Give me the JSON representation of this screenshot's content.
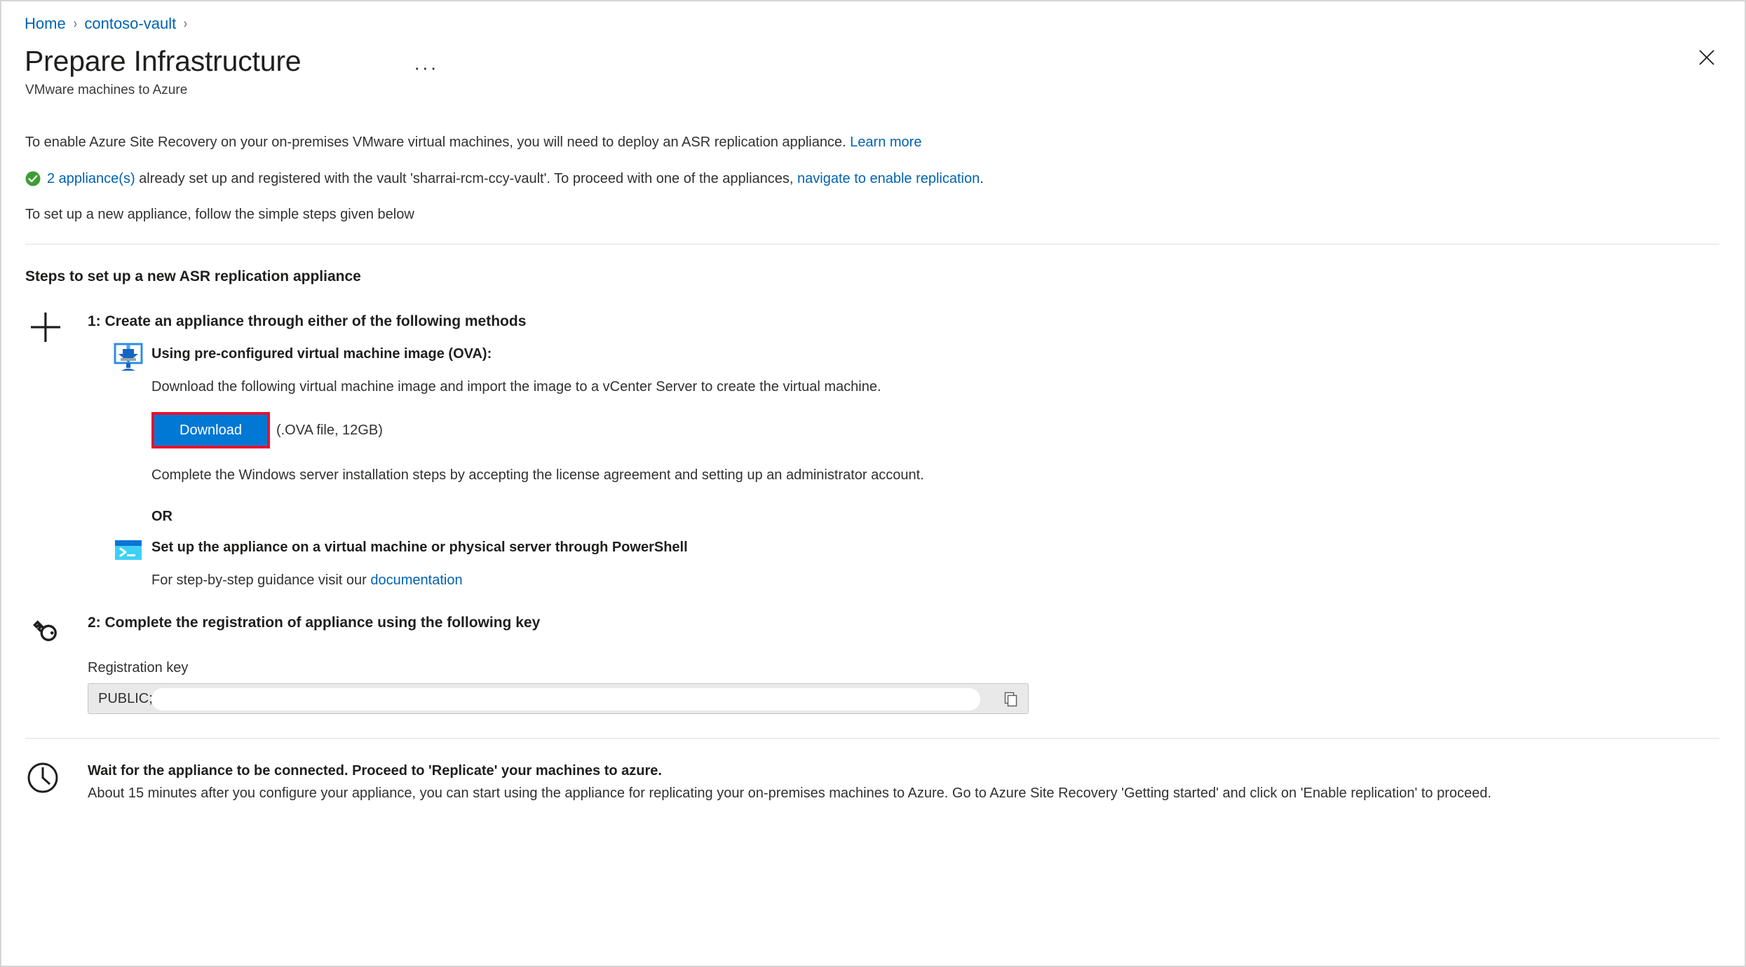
{
  "breadcrumb": {
    "items": [
      {
        "label": "Home"
      },
      {
        "label": "contoso-vault"
      }
    ],
    "separator": "›"
  },
  "header": {
    "title": "Prepare Infrastructure",
    "subtitle": "VMware machines to Azure",
    "more_label": "···",
    "close_label": "✕"
  },
  "intro": {
    "line1_text": "To enable Azure Site Recovery on your on-premises VMware virtual machines, you will need to deploy an ASR replication appliance. ",
    "line1_link": "Learn more",
    "status_link": "2 appliance(s)",
    "status_text_mid": " already set up and registered with the vault 'sharrai-rcm-ccy-vault'. To proceed with one of the appliances, ",
    "status_link2": "navigate to enable replication",
    "status_text_end": ".",
    "line3": "To set up a new appliance, follow the simple steps given below"
  },
  "steps": {
    "heading": "Steps to set up a new ASR replication appliance",
    "step1": {
      "title": "1: Create an appliance through either of the following methods",
      "method_ova": {
        "title": "Using pre-configured virtual machine image (OVA):",
        "body": "Download the following virtual machine image and import the image to a vCenter Server to create the virtual machine.",
        "download_label": "Download",
        "download_note": "(.OVA file, 12GB)",
        "post_text": "Complete the Windows server installation steps by accepting the license agreement and setting up an administrator account."
      },
      "or_label": "OR",
      "method_ps": {
        "title": "Set up the appliance on a virtual machine or physical server through PowerShell",
        "body_prefix": "For step-by-step guidance visit our ",
        "body_link": "documentation"
      }
    },
    "step2": {
      "title": "2: Complete the registration of appliance using the following key",
      "field_label": "Registration key",
      "field_value": "PUBLIC;",
      "copy_tooltip": "Copy to clipboard"
    }
  },
  "footer": {
    "title": "Wait for the appliance to be connected. Proceed to 'Replicate' your machines to azure.",
    "text": "About 15 minutes after you configure your appliance, you can start using the appliance for replicating your on-premises machines to Azure. Go to Azure Site Recovery 'Getting started' and click on 'Enable replication' to proceed."
  },
  "colors": {
    "accent": "#0078d4",
    "link": "#0063b1",
    "highlight": "#e8112d",
    "success": "#3e9c35"
  }
}
